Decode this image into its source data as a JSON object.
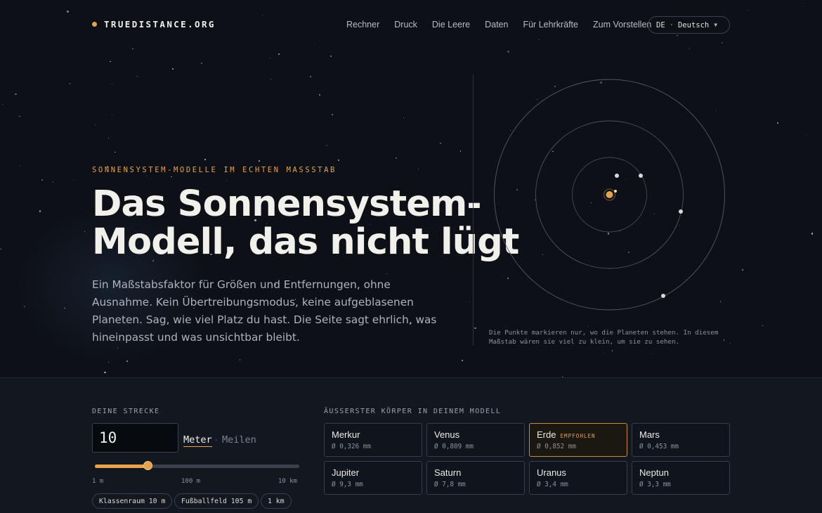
{
  "header": {
    "brand": "TRUEDISTANCE.ORG",
    "nav": [
      "Rechner",
      "Druck",
      "Die Leere",
      "Daten",
      "Für Lehrkräfte",
      "Zum Vorstellen"
    ],
    "lang_code": "DE",
    "lang_name": "Deutsch"
  },
  "hero": {
    "eyebrow": "SONNENSYSTEM-MODELLE IM ECHTEN MASSSTAB",
    "title_line1": "Das Sonnensystem-",
    "title_line2": "Modell, das nicht lügt",
    "lead": "Ein Maßstabsfaktor für Größen und Entfernungen, ohne Ausnahme. Kein Übertreibungsmodus, keine aufgeblasenen Planeten. Sag, wie viel Platz du hast. Die Seite sagt ehrlich, was hineinpasst und was unsichtbar bleibt.",
    "orbit_note": "Die Punkte markieren nur, wo die Planeten stehen. In diesem Maßstab wären sie viel zu klein, um sie zu sehen."
  },
  "calculator": {
    "distance_label": "DEINE STRECKE",
    "distance_value": "10",
    "unit_active": "Meter",
    "unit_inactive": "Meilen",
    "slider_fraction": 0.26,
    "slider_ticks": [
      "1 m",
      "100 m",
      "10 km"
    ],
    "presets": [
      "Klassenraum 10 m",
      "Fußballfeld 105 m",
      "1 km"
    ],
    "outer_label": "ÄUSSERSTER KÖRPER IN DEINEM MODELL",
    "recommended_badge": "EMPFOHLEN",
    "planets": [
      {
        "name": "Merkur",
        "diameter": "Ø 0,326 mm",
        "selected": false
      },
      {
        "name": "Venus",
        "diameter": "Ø 0,809 mm",
        "selected": false
      },
      {
        "name": "Erde",
        "diameter": "Ø 0,852 mm",
        "selected": true
      },
      {
        "name": "Mars",
        "diameter": "Ø 0,453 mm",
        "selected": false
      },
      {
        "name": "Jupiter",
        "diameter": "Ø 9,3 mm",
        "selected": false
      },
      {
        "name": "Saturn",
        "diameter": "Ø 7,8 mm",
        "selected": false
      },
      {
        "name": "Uranus",
        "diameter": "Ø 3,4 mm",
        "selected": false
      },
      {
        "name": "Neptun",
        "diameter": "Ø 3,3 mm",
        "selected": false
      }
    ]
  },
  "colors": {
    "accent": "#e8a24a",
    "background": "#0d1016",
    "panel": "#131720"
  }
}
